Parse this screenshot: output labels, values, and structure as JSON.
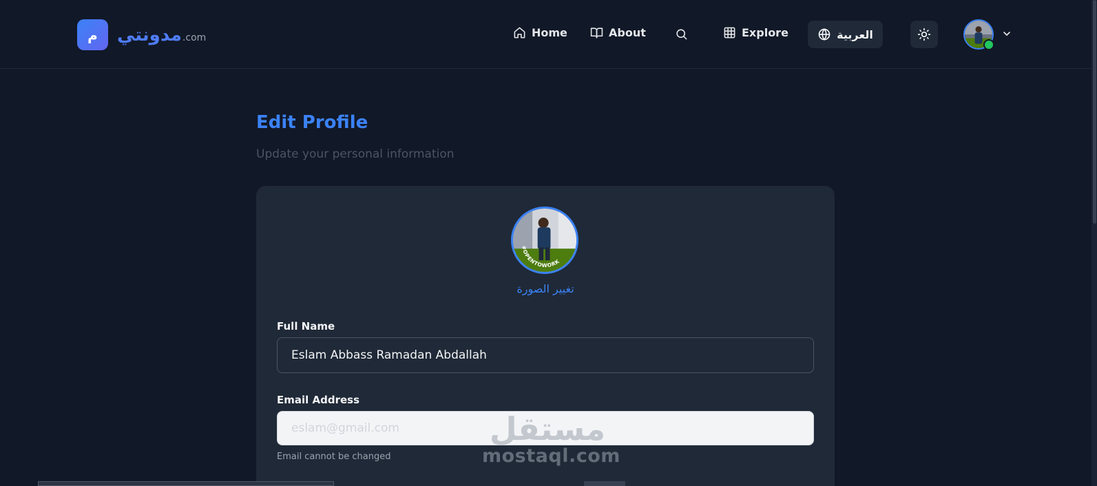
{
  "logo": {
    "badge": "م",
    "name": "مدونتي",
    "tld": ".com"
  },
  "nav": {
    "home": "Home",
    "about": "About",
    "explore": "Explore",
    "language": "العربية"
  },
  "page": {
    "title": "Edit Profile",
    "subtitle": "Update your personal information"
  },
  "form": {
    "change_photo": "تغيير الصورة",
    "full_name_label": "Full Name",
    "full_name_value": "Eslam Abbass Ramadan Abdallah",
    "email_label": "Email Address",
    "email_placeholder": "eslam@gmail.com",
    "email_hint": "Email cannot be changed"
  },
  "profile_photo": {
    "caption": "#OPENTOWORK"
  },
  "watermark": {
    "arabic": "مستقل",
    "latin": "mostaql.com"
  },
  "colors": {
    "accent": "#3b82f6",
    "online": "#22c55e",
    "background": "#111827",
    "card": "#1f2937"
  }
}
